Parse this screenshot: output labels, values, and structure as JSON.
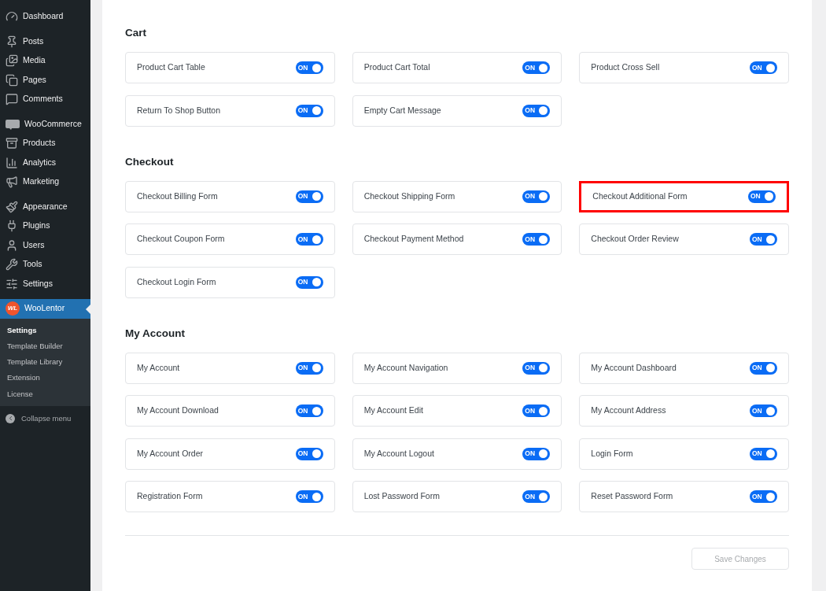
{
  "sidebar": {
    "groups": [
      {
        "items": [
          {
            "label": "Dashboard",
            "selected": false
          }
        ]
      },
      {
        "items": [
          {
            "label": "Posts",
            "selected": false
          },
          {
            "label": "Media",
            "selected": false
          },
          {
            "label": "Pages",
            "selected": false
          },
          {
            "label": "Comments",
            "selected": false
          }
        ]
      },
      {
        "items": [
          {
            "label": "WooCommerce",
            "selected": false
          },
          {
            "label": "Products",
            "selected": false
          },
          {
            "label": "Analytics",
            "selected": false
          },
          {
            "label": "Marketing",
            "selected": false
          }
        ]
      },
      {
        "items": [
          {
            "label": "Appearance",
            "selected": false
          },
          {
            "label": "Plugins",
            "selected": false
          },
          {
            "label": "Users",
            "selected": false
          },
          {
            "label": "Tools",
            "selected": false
          },
          {
            "label": "Settings",
            "selected": false
          }
        ]
      },
      {
        "items": [
          {
            "label": "WooLentor",
            "logo_text": "WL",
            "selected": true,
            "children": [
              {
                "label": "Settings",
                "selected": true
              },
              {
                "label": "Template Builder",
                "selected": false
              },
              {
                "label": "Template Library",
                "selected": false
              },
              {
                "label": "Extension",
                "selected": false
              },
              {
                "label": "License",
                "selected": false
              }
            ]
          }
        ]
      }
    ],
    "collapse": "Collapse menu"
  },
  "sections": [
    {
      "title": "Cart",
      "items": [
        {
          "label": "Product Cart Table",
          "toggle": "ON",
          "on": true,
          "highlighted": false
        },
        {
          "label": "Product Cart Total",
          "toggle": "ON",
          "on": true,
          "highlighted": false
        },
        {
          "label": "Product Cross Sell",
          "toggle": "ON",
          "on": true,
          "highlighted": false
        },
        {
          "label": "Return To Shop Button",
          "toggle": "ON",
          "on": true,
          "highlighted": false
        },
        {
          "label": "Empty Cart Message",
          "toggle": "ON",
          "on": true,
          "highlighted": false
        }
      ]
    },
    {
      "title": "Checkout",
      "items": [
        {
          "label": "Checkout Billing Form",
          "toggle": "ON",
          "on": true,
          "highlighted": false
        },
        {
          "label": "Checkout Shipping Form",
          "toggle": "ON",
          "on": true,
          "highlighted": false
        },
        {
          "label": "Checkout Additional Form",
          "toggle": "ON",
          "on": true,
          "highlighted": true
        },
        {
          "label": "Checkout Coupon Form",
          "toggle": "ON",
          "on": true,
          "highlighted": false
        },
        {
          "label": "Checkout Payment Method",
          "toggle": "ON",
          "on": true,
          "highlighted": false
        },
        {
          "label": "Checkout Order Review",
          "toggle": "ON",
          "on": true,
          "highlighted": false
        },
        {
          "label": "Checkout Login Form",
          "toggle": "ON",
          "on": true,
          "highlighted": false
        }
      ]
    },
    {
      "title": "My Account",
      "items": [
        {
          "label": "My Account",
          "toggle": "ON",
          "on": true,
          "highlighted": false
        },
        {
          "label": "My Account Navigation",
          "toggle": "ON",
          "on": true,
          "highlighted": false
        },
        {
          "label": "My Account Dashboard",
          "toggle": "ON",
          "on": true,
          "highlighted": false
        },
        {
          "label": "My Account Download",
          "toggle": "ON",
          "on": true,
          "highlighted": false
        },
        {
          "label": "My Account Edit",
          "toggle": "ON",
          "on": true,
          "highlighted": false
        },
        {
          "label": "My Account Address",
          "toggle": "ON",
          "on": true,
          "highlighted": false
        },
        {
          "label": "My Account Order",
          "toggle": "ON",
          "on": true,
          "highlighted": false
        },
        {
          "label": "My Account Logout",
          "toggle": "ON",
          "on": true,
          "highlighted": false
        },
        {
          "label": "Login Form",
          "toggle": "ON",
          "on": true,
          "highlighted": false
        },
        {
          "label": "Registration Form",
          "toggle": "ON",
          "on": true,
          "highlighted": false
        },
        {
          "label": "Lost Password Form",
          "toggle": "ON",
          "on": true,
          "highlighted": false
        },
        {
          "label": "Reset Password Form",
          "toggle": "ON",
          "on": true,
          "highlighted": false
        }
      ]
    }
  ],
  "save_button": {
    "label": "Save Changes",
    "disabled": true
  }
}
